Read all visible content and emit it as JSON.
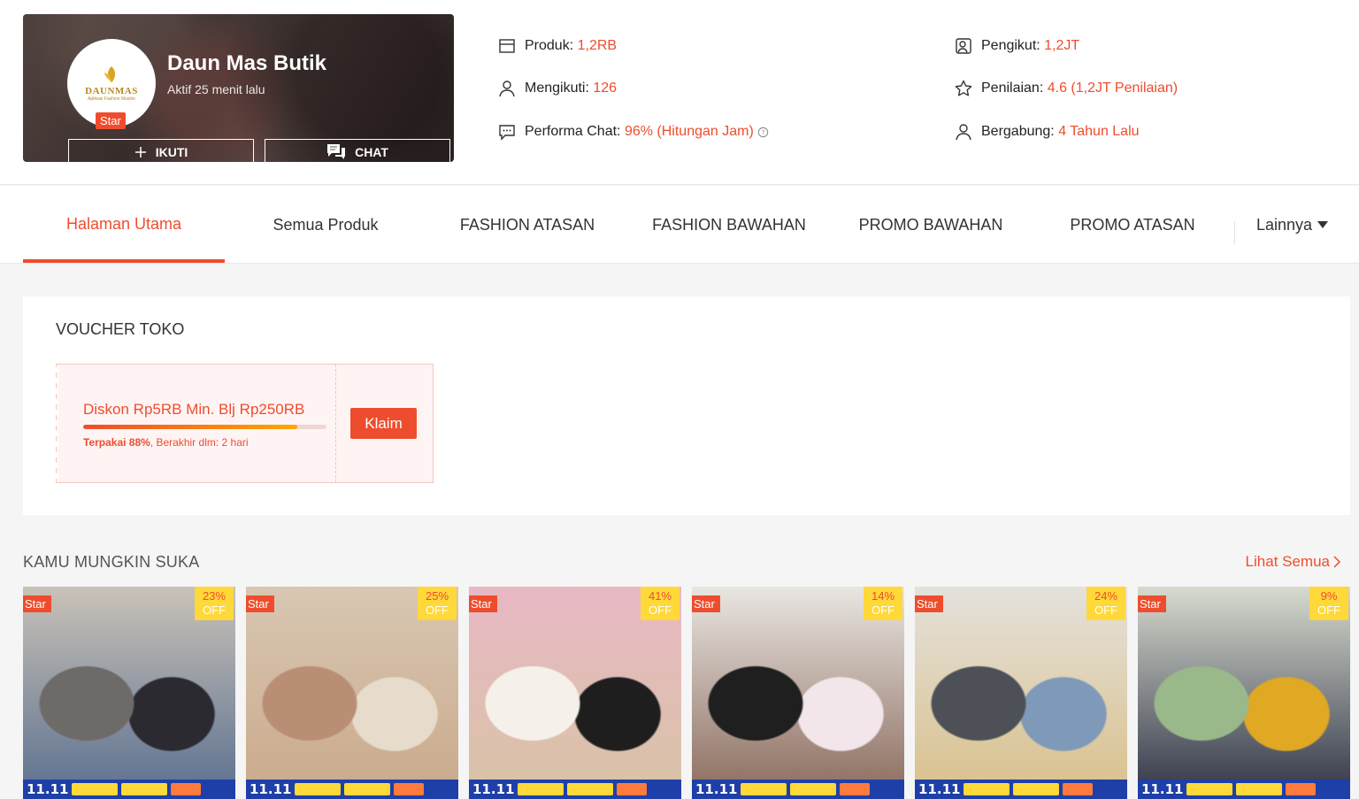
{
  "shop": {
    "name": "Daun Mas Butik",
    "active": "Aktif 25 menit lalu",
    "logo_text": "DAUNMAS",
    "logo_sub": "Aplikasi Fashion Muslim",
    "badge": "Star",
    "follow_label": "IKUTI",
    "chat_label": "CHAT"
  },
  "stats": {
    "products_label": "Produk:",
    "products_value": "1,2RB",
    "following_label": "Mengikuti:",
    "following_value": "126",
    "chat_label": "Performa Chat:",
    "chat_value": "96% (Hitungan Jam)",
    "followers_label": "Pengikut:",
    "followers_value": "1,2JT",
    "rating_label": "Penilaian:",
    "rating_value": "4.6 (1,2JT Penilaian)",
    "joined_label": "Bergabung:",
    "joined_value": "4 Tahun Lalu"
  },
  "nav": {
    "tabs": [
      {
        "label": "Halaman Utama"
      },
      {
        "label": "Semua Produk"
      },
      {
        "label": "FASHION ATASAN"
      },
      {
        "label": "FASHION BAWAHAN"
      },
      {
        "label": "PROMO BAWAHAN"
      },
      {
        "label": "PROMO ATASAN"
      }
    ],
    "more_label": "Lainnya"
  },
  "voucher": {
    "title": "VOUCHER TOKO",
    "description": "Diskon Rp5RB Min. Blj Rp250RB",
    "used_label": "Terpakai 88%",
    "used_fraction": 0.88,
    "expiry": ", Berakhir dlm: 2 hari",
    "claim_label": "Klaim"
  },
  "recommended": {
    "title": "KAMU MUNGKIN SUKA",
    "see_all": "Lihat Semua",
    "badge": "Star",
    "off_label": "OFF",
    "sale_label": "11.11",
    "products": [
      {
        "discount": "23%"
      },
      {
        "discount": "25%"
      },
      {
        "discount": "41%"
      },
      {
        "discount": "14%"
      },
      {
        "discount": "24%"
      },
      {
        "discount": "9%"
      }
    ]
  },
  "colors": {
    "accent": "#ee4d2d",
    "promo_yellow": "#ffd839",
    "promo_blue": "#1e3fa8"
  }
}
